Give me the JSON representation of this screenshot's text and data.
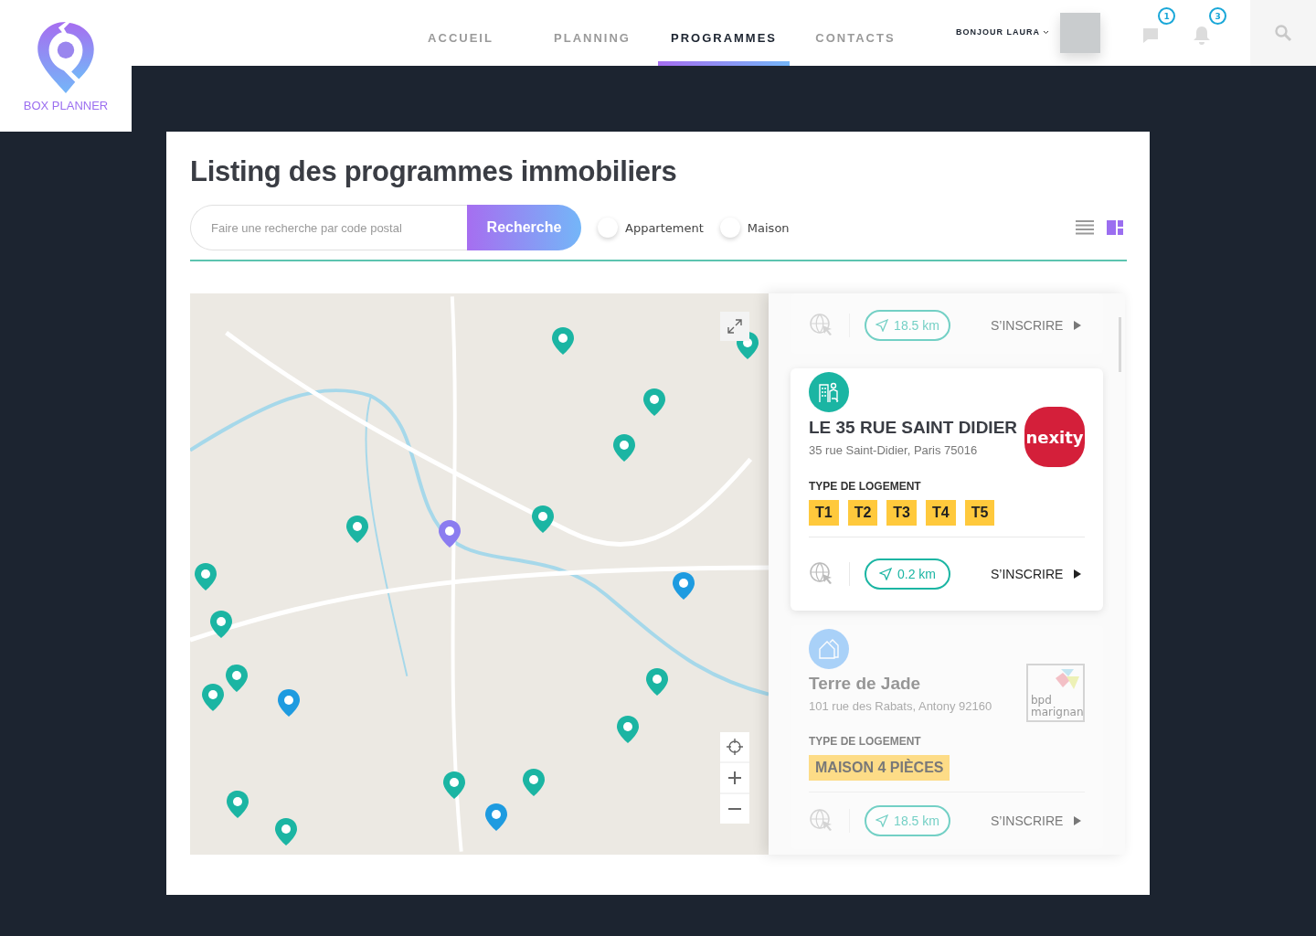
{
  "brand": {
    "name": "BOX PLANNER"
  },
  "nav": [
    {
      "label": "ACCUEIL",
      "selected": false
    },
    {
      "label": "PLANNING",
      "selected": false
    },
    {
      "label": "PROGRAMMES",
      "selected": true
    },
    {
      "label": "CONTACTS",
      "selected": false
    }
  ],
  "user": {
    "greeting": "BONJOUR LAURA",
    "messages_badge": "1",
    "notifications_badge": "3"
  },
  "page": {
    "title": "Listing des programmes immobiliers"
  },
  "search": {
    "placeholder": "Faire une recherche par code postal",
    "button": "Recherche"
  },
  "filters": [
    {
      "label": "Appartement",
      "checked": false
    },
    {
      "label": "Maison",
      "checked": false
    }
  ],
  "views": [
    {
      "kind": "list",
      "selected": false
    },
    {
      "kind": "grid",
      "selected": true
    }
  ],
  "programs": [
    {
      "focused": false,
      "partial": true,
      "distance": "18.5 km",
      "action": "S’INSCRIRE"
    },
    {
      "focused": true,
      "partial": false,
      "kind": "building",
      "name": "LE 35 RUE SAINT DIDIER",
      "address": "35 rue Saint-Didier, Paris 75016",
      "logo": {
        "kind": "nexity",
        "text": "nexity"
      },
      "type_label": "TYPE DE LOGEMENT",
      "types": [
        "T1",
        "T2",
        "T3",
        "T4",
        "T5"
      ],
      "distance": "0.2 km",
      "action": "S’INSCRIRE"
    },
    {
      "focused": false,
      "partial": false,
      "kind": "house",
      "name": "Terre de Jade",
      "address": "101 rue des Rabats, Antony 92160",
      "logo": {
        "kind": "bpd",
        "text": "bpd marignan"
      },
      "type_label": "TYPE DE LOGEMENT",
      "types": [
        "MAISON 4 PIÈCES"
      ],
      "distance": "18.5 km",
      "action": "S’INSCRIRE"
    }
  ]
}
